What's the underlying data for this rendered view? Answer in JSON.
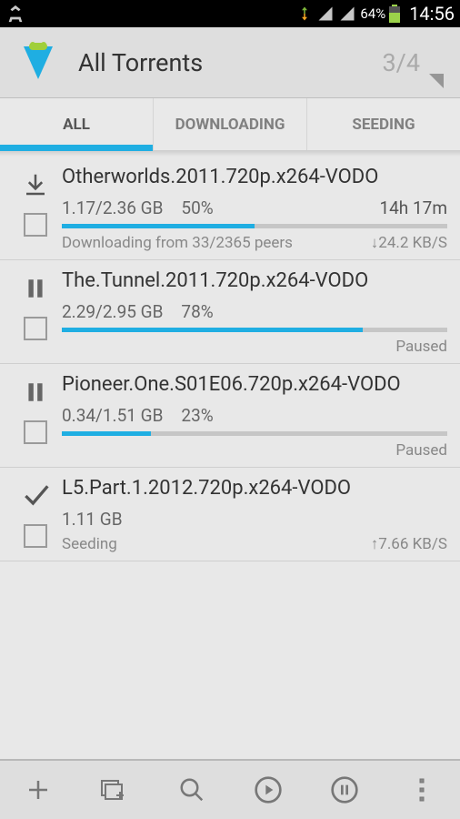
{
  "statusbar": {
    "battery_pct": "64%",
    "time": "14:56"
  },
  "appbar": {
    "title": "All Torrents",
    "count": "3/4"
  },
  "tabs": [
    {
      "label": "ALL",
      "active": true
    },
    {
      "label": "DOWNLOADING",
      "active": false
    },
    {
      "label": "SEEDING",
      "active": false
    }
  ],
  "torrents": [
    {
      "state": "downloading",
      "name": "Otherworlds.2011.720p.x264-VODO",
      "size": "1.17/2.36 GB",
      "percent_text": "50%",
      "percent": 50,
      "eta": "14h 17m",
      "status": "Downloading from 33/2365 peers",
      "speed": "↓24.2 KB/S"
    },
    {
      "state": "paused",
      "name": "The.Tunnel.2011.720p.x264-VODO",
      "size": "2.29/2.95 GB",
      "percent_text": "78%",
      "percent": 78,
      "eta": "",
      "status": "",
      "speed": "Paused"
    },
    {
      "state": "paused",
      "name": "Pioneer.One.S01E06.720p.x264-VODO",
      "size": "0.34/1.51 GB",
      "percent_text": "23%",
      "percent": 23,
      "eta": "",
      "status": "",
      "speed": "Paused"
    },
    {
      "state": "done",
      "name": "L5.Part.1.2012.720p.x264-VODO",
      "size": "1.11 GB",
      "percent_text": "",
      "percent": 0,
      "eta": "",
      "status": "Seeding",
      "speed": "↑7.66 KB/S"
    }
  ],
  "colors": {
    "accent": "#1faee2"
  }
}
